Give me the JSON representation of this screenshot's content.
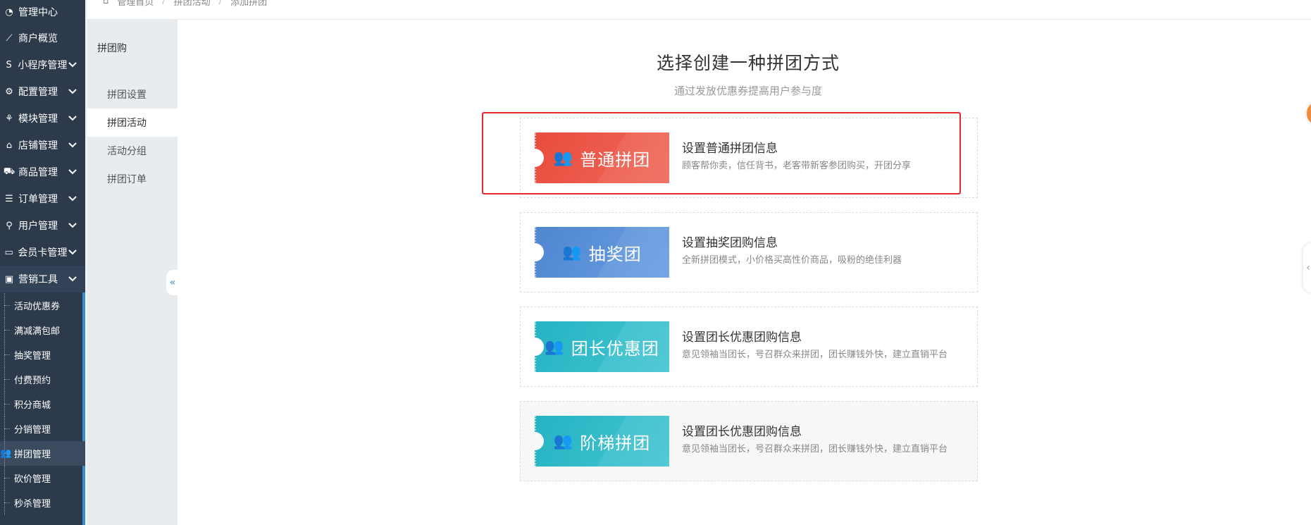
{
  "breadcrumb": [
    "管理首页",
    "拼团活动",
    "添加拼团"
  ],
  "sidebar": {
    "items": [
      {
        "label": "管理中心",
        "icon": "dashboard-icon",
        "glyph": "◔",
        "chevron": false
      },
      {
        "label": "商户概览",
        "icon": "trend-icon",
        "glyph": "⟋",
        "chevron": false
      },
      {
        "label": "小程序管理",
        "icon": "miniprogram-icon",
        "glyph": "S",
        "chevron": true
      },
      {
        "label": "配置管理",
        "icon": "gear-icon",
        "glyph": "⚙",
        "chevron": true
      },
      {
        "label": "模块管理",
        "icon": "modules-icon",
        "glyph": "⚘",
        "chevron": true
      },
      {
        "label": "店铺管理",
        "icon": "store-icon",
        "glyph": "⌂",
        "chevron": true
      },
      {
        "label": "商品管理",
        "icon": "cart-icon",
        "glyph": "⛟",
        "chevron": true
      },
      {
        "label": "订单管理",
        "icon": "order-list-icon",
        "glyph": "☰",
        "chevron": true
      },
      {
        "label": "用户管理",
        "icon": "user-icon",
        "glyph": "⚲",
        "chevron": true
      },
      {
        "label": "会员卡管理",
        "icon": "card-icon",
        "glyph": "▭",
        "chevron": true
      },
      {
        "label": "营销工具",
        "icon": "briefcase-icon",
        "glyph": "▣",
        "chevron": true
      }
    ],
    "sub_items": [
      "活动优惠券",
      "满减满包邮",
      "抽奖管理",
      "付费预约",
      "积分商城",
      "分销管理",
      "拼团管理",
      "砍价管理",
      "秒杀管理"
    ],
    "active_sub": "拼团管理"
  },
  "subnav": {
    "title": "拼团购",
    "items": [
      "拼团设置",
      "拼团活动",
      "活动分组",
      "拼团订单"
    ],
    "active": "拼团活动"
  },
  "main": {
    "title": "选择创建一种拼团方式",
    "subtitle": "通过发放优惠券提高用户参与度",
    "cards": [
      {
        "ticket": "普通拼团",
        "title": "设置普通拼团信息",
        "desc": "顾客帮你卖，信任背书，老客带新客参团购买，开团分享",
        "color": "#e84c3d",
        "color2": "#f0695a"
      },
      {
        "ticket": "抽奖团",
        "title": "设置抽奖团购信息",
        "desc": "全新拼团模式，小价格买高性价商品，吸粉的绝佳利器",
        "color": "#4f86d0",
        "color2": "#6a9ee2"
      },
      {
        "ticket": "团长优惠团",
        "title": "设置团长优惠团购信息",
        "desc": "意见领袖当团长，号召群众来拼团，团长赚钱外快，建立直销平台",
        "color": "#25b3c2",
        "color2": "#44c6d3"
      },
      {
        "ticket": "阶梯拼团",
        "title": "设置团长优惠团购信息",
        "desc": "意见领袖当团长，号召群众来拼团，团长赚钱外快，建立直销平台",
        "color": "#25b3c2",
        "color2": "#44c6d3"
      }
    ]
  },
  "colors": {
    "sidebar_bg": "#2d3a4b",
    "accent": "#3b8ed6",
    "highlight": "#e8282c"
  }
}
